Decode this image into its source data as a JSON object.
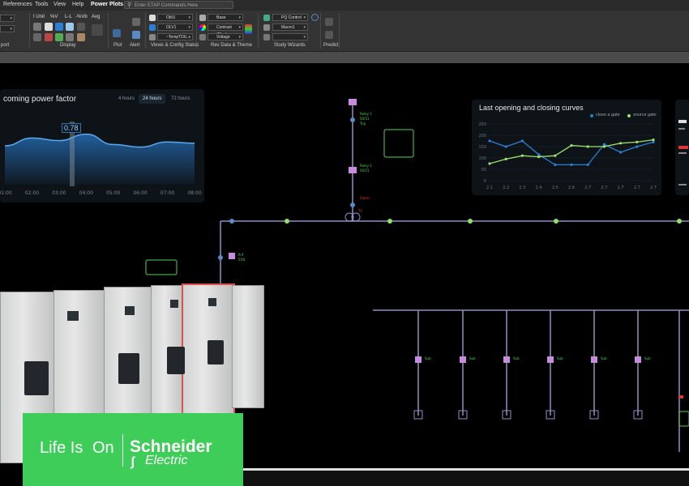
{
  "menu": [
    "References",
    "Tools",
    "View",
    "Help",
    "Power Plots"
  ],
  "command_search": {
    "placeholder": "Enter ETAP Commands Here"
  },
  "ribbon": {
    "group_labels": [
      "port",
      "Display",
      "Plot",
      "Alert",
      "Views & Config Status",
      "Rev Data & Theme",
      "Study Wizards",
      "Predict"
    ],
    "display_toggles": [
      "I Unit",
      "%V",
      "L-L",
      "-%Vb",
      "Avg"
    ],
    "combos": {
      "view1": "Ol/ii1",
      "view2": "OLV1",
      "view3": "~TempTDU...",
      "base": "Base",
      "theme": "Contrast (Black...",
      "voltage": "Voltage",
      "pq": "PQ Control",
      "macro": "Macro1",
      "blank": ""
    }
  },
  "power_factor": {
    "title": "coming power factor",
    "tabs": [
      "4 hours",
      "24 hours",
      "72 hours"
    ],
    "active_tab": "24 hours",
    "marker_value": "0.78"
  },
  "opening_closing": {
    "title": "Last opening and closing curves",
    "legend": [
      "close a gate",
      "source gate"
    ]
  },
  "colors": {
    "accent_blue": "#2a7fd4",
    "green_series": "#9ee06a",
    "bus": "#8f8fc4",
    "brand_green": "#3dcd58",
    "alert_red": "#e23434"
  },
  "brand": {
    "tagline_left": "Life Is",
    "tagline_on": "On",
    "company": "Schneider",
    "company_sub": "Electric"
  },
  "chart_data": [
    {
      "type": "area",
      "title": "coming power factor",
      "categories": [
        "01:00",
        "02:00",
        "03:00",
        "04:00",
        "05:00",
        "06:00",
        "07:00",
        "08:00"
      ],
      "values": [
        0.6,
        0.72,
        0.68,
        0.78,
        0.62,
        0.58,
        0.66,
        0.64
      ],
      "ylim": [
        0,
        1
      ],
      "grid": false
    },
    {
      "type": "line",
      "title": "Last opening and closing curves",
      "categories": [
        "2.1",
        "2.2",
        "2.3",
        "2.4",
        "2.5",
        "2.6",
        "2.7",
        "2.7",
        "2.7",
        "2.7",
        "2.7"
      ],
      "y_ticks": [
        "0",
        "50",
        "100",
        "150",
        "200",
        "250"
      ],
      "ylim": [
        0,
        250
      ],
      "series": [
        {
          "name": "close a gate",
          "values": [
            175,
            150,
            175,
            115,
            70,
            70,
            70,
            160,
            125,
            150,
            170
          ]
        },
        {
          "name": "source gate",
          "values": [
            75,
            95,
            110,
            105,
            110,
            155,
            150,
            150,
            165,
            170,
            180
          ]
        }
      ],
      "legend": "top-right",
      "grid": true
    }
  ]
}
